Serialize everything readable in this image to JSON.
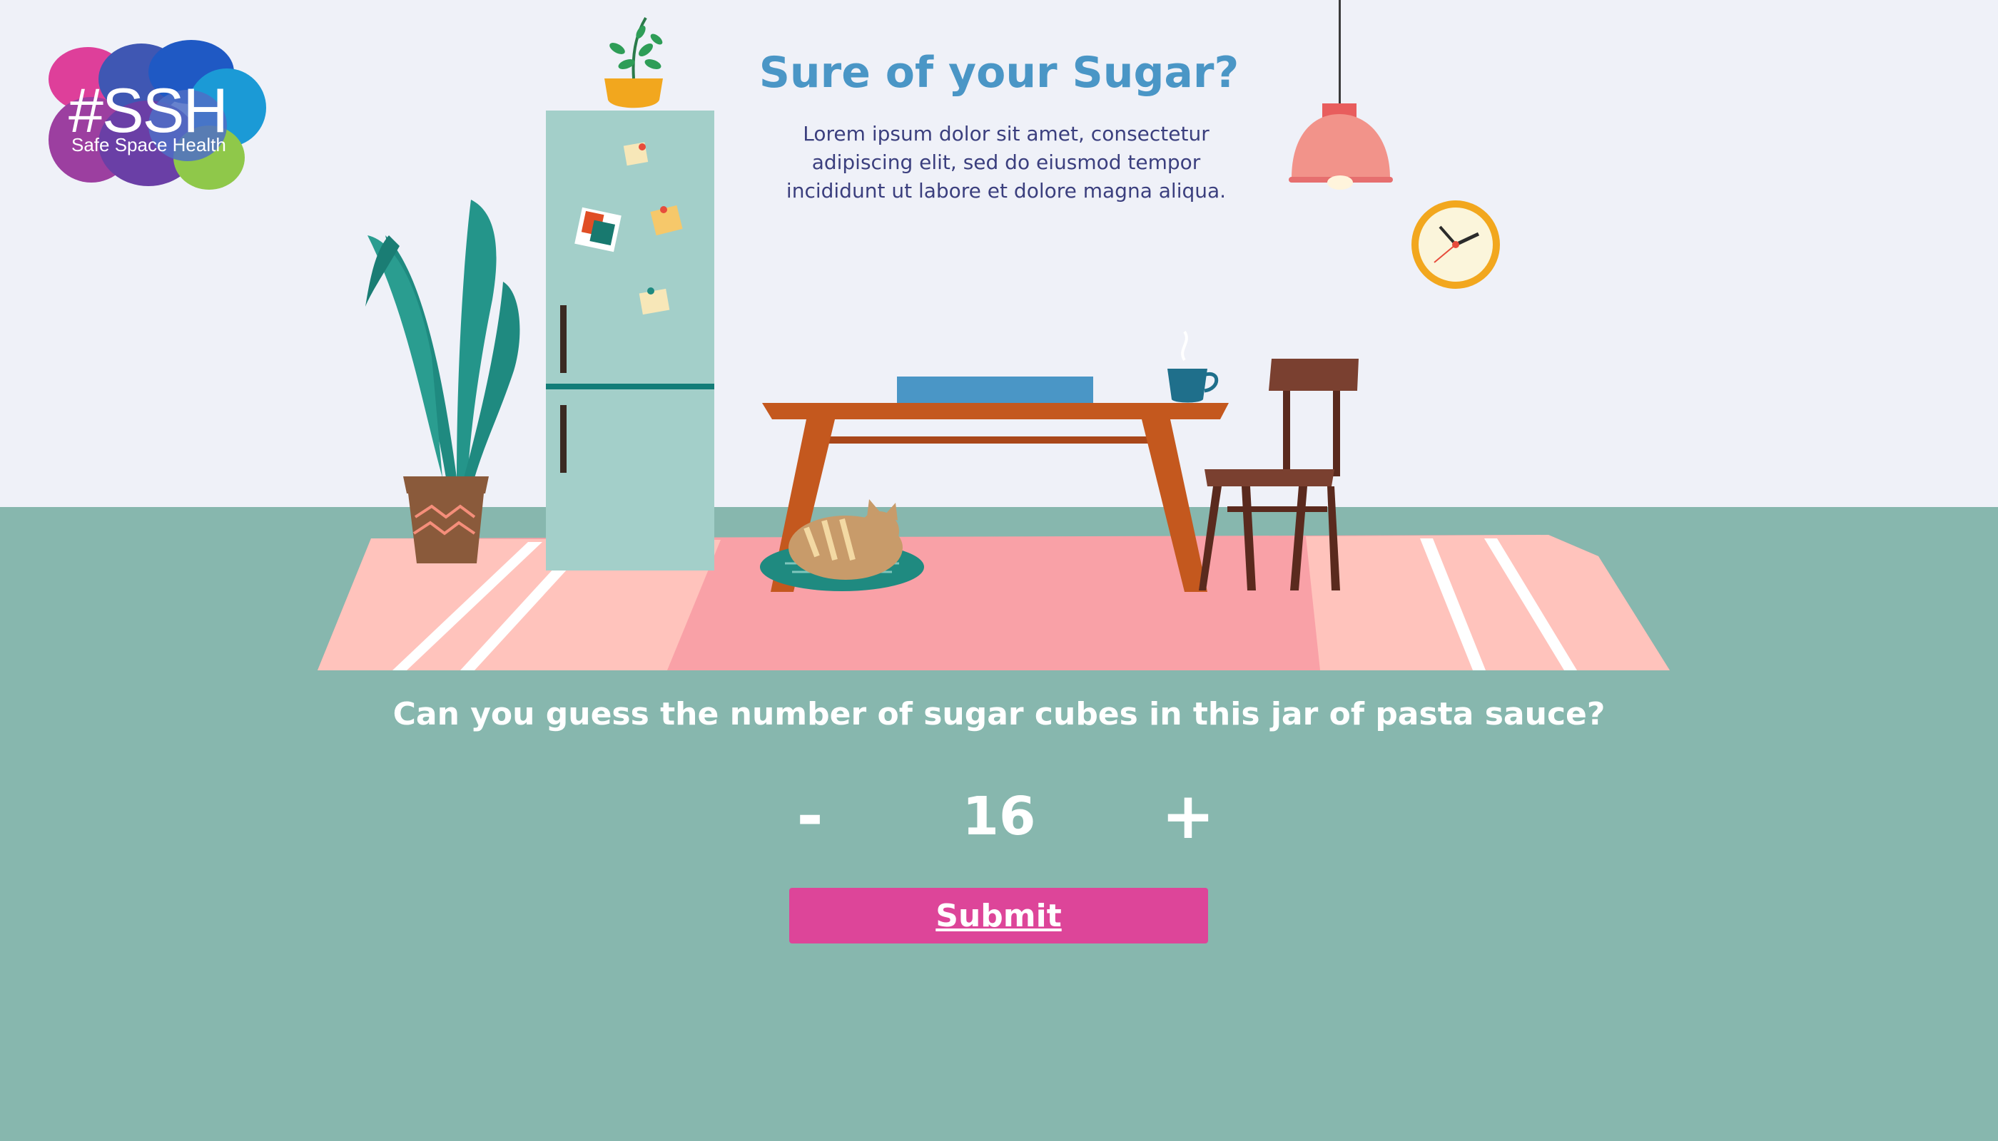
{
  "logo": {
    "text": "#SSH",
    "subtitle": "Safe Space Health"
  },
  "header": {
    "title": "Sure of your Sugar?",
    "body": "Lorem ipsum dolor sit amet, consectetur adipiscing elit, sed do eiusmod tempor incididunt ut labore et dolore magna aliqua."
  },
  "quiz": {
    "question": "Can you guess the number of sugar cubes in this jar of pasta sauce?",
    "minus_label": "-",
    "plus_label": "+",
    "count": "16",
    "submit_label": "Submit"
  },
  "colors": {
    "wall": "#eff1f8",
    "floor": "#87b7ae",
    "title": "#4a96c6",
    "body_text": "#3b3f7e",
    "submit": "#dd4599",
    "rug": "#f6a3a9"
  },
  "icons": {
    "clock": "wall-clock-icon",
    "lamp": "pendant-lamp-icon",
    "plant": "potted-plant-icon",
    "fridge": "fridge-icon"
  }
}
